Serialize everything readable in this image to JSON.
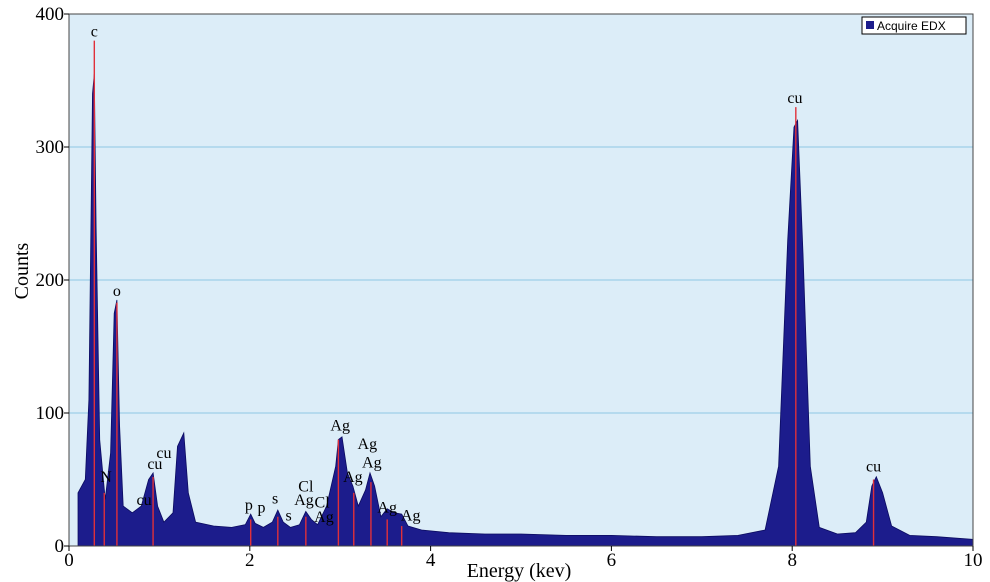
{
  "chart_data": {
    "type": "area",
    "title": "",
    "xlabel": "Energy (kev)",
    "ylabel": "Counts",
    "xlim": [
      0,
      10
    ],
    "ylim": [
      0,
      400
    ],
    "x_ticks": [
      "0",
      "2",
      "4",
      "6",
      "8",
      "10"
    ],
    "y_ticks": [
      "0",
      "100",
      "200",
      "300",
      "400"
    ],
    "grid": "horizontal",
    "legend_position": "top-right",
    "colors": {
      "fill": "#1c1c8c",
      "marker": "#e0303a",
      "background": "#dcedf8",
      "grid": "#8ec8e4"
    },
    "series": [
      {
        "name": "Acquire EDX",
        "x": [
          0.1,
          0.18,
          0.22,
          0.26,
          0.28,
          0.3,
          0.34,
          0.4,
          0.46,
          0.5,
          0.53,
          0.56,
          0.6,
          0.7,
          0.8,
          0.88,
          0.93,
          0.98,
          1.05,
          1.15,
          1.2,
          1.27,
          1.32,
          1.4,
          1.6,
          1.8,
          1.95,
          2.01,
          2.06,
          2.15,
          2.25,
          2.31,
          2.37,
          2.45,
          2.55,
          2.62,
          2.68,
          2.75,
          2.85,
          2.95,
          2.98,
          3.02,
          3.08,
          3.14,
          3.2,
          3.28,
          3.33,
          3.38,
          3.45,
          3.52,
          3.6,
          3.68,
          3.75,
          3.9,
          4.2,
          4.6,
          5.0,
          5.5,
          6.0,
          6.5,
          7.0,
          7.4,
          7.7,
          7.85,
          7.95,
          8.02,
          8.06,
          8.12,
          8.2,
          8.3,
          8.5,
          8.7,
          8.82,
          8.88,
          8.93,
          9.0,
          9.1,
          9.3,
          9.6,
          10.0
        ],
        "values": [
          40,
          50,
          110,
          340,
          355,
          240,
          80,
          35,
          70,
          175,
          185,
          90,
          30,
          25,
          30,
          50,
          55,
          30,
          18,
          25,
          75,
          85,
          40,
          18,
          15,
          14,
          16,
          24,
          17,
          14,
          18,
          27,
          18,
          14,
          16,
          26,
          20,
          16,
          30,
          60,
          80,
          82,
          55,
          45,
          30,
          42,
          55,
          45,
          22,
          28,
          25,
          24,
          15,
          12,
          10,
          9,
          9,
          8,
          8,
          7,
          7,
          8,
          12,
          60,
          230,
          315,
          320,
          220,
          60,
          14,
          9,
          10,
          18,
          45,
          52,
          40,
          15,
          8,
          7,
          5
        ]
      }
    ],
    "peak_labels": [
      {
        "text": "c",
        "x": 0.28,
        "y": 380
      },
      {
        "text": "N",
        "x": 0.41,
        "y": 45
      },
      {
        "text": "o",
        "x": 0.53,
        "y": 185
      },
      {
        "text": "cu",
        "x": 0.83,
        "y": 28
      },
      {
        "text": "cu",
        "x": 0.95,
        "y": 55
      },
      {
        "text": "cu",
        "x": 1.05,
        "y": 63
      },
      {
        "text": "p",
        "x": 1.99,
        "y": 24
      },
      {
        "text": "p",
        "x": 2.13,
        "y": 22
      },
      {
        "text": "s",
        "x": 2.28,
        "y": 29
      },
      {
        "text": "s",
        "x": 2.43,
        "y": 16
      },
      {
        "text": "Ag",
        "x": 2.6,
        "y": 28
      },
      {
        "text": "Cl",
        "x": 2.62,
        "y": 38
      },
      {
        "text": "Cl",
        "x": 2.8,
        "y": 26
      },
      {
        "text": "Ag",
        "x": 2.82,
        "y": 15
      },
      {
        "text": "Ag",
        "x": 3.0,
        "y": 84
      },
      {
        "text": "Ag",
        "x": 3.14,
        "y": 45
      },
      {
        "text": "Ag",
        "x": 3.3,
        "y": 70
      },
      {
        "text": "Ag",
        "x": 3.35,
        "y": 56
      },
      {
        "text": "Ag",
        "x": 3.52,
        "y": 22
      },
      {
        "text": "Ag",
        "x": 3.78,
        "y": 16
      },
      {
        "text": "cu",
        "x": 8.03,
        "y": 330
      },
      {
        "text": "cu",
        "x": 8.9,
        "y": 53
      }
    ],
    "markers": [
      {
        "x": 0.28,
        "y": 380
      },
      {
        "x": 0.39,
        "y": 40
      },
      {
        "x": 0.53,
        "y": 183
      },
      {
        "x": 0.93,
        "y": 52
      },
      {
        "x": 2.01,
        "y": 20
      },
      {
        "x": 2.31,
        "y": 22
      },
      {
        "x": 2.62,
        "y": 22
      },
      {
        "x": 2.98,
        "y": 80
      },
      {
        "x": 3.15,
        "y": 40
      },
      {
        "x": 3.34,
        "y": 48
      },
      {
        "x": 3.52,
        "y": 20
      },
      {
        "x": 3.68,
        "y": 15
      },
      {
        "x": 8.04,
        "y": 330
      },
      {
        "x": 8.9,
        "y": 50
      }
    ]
  }
}
